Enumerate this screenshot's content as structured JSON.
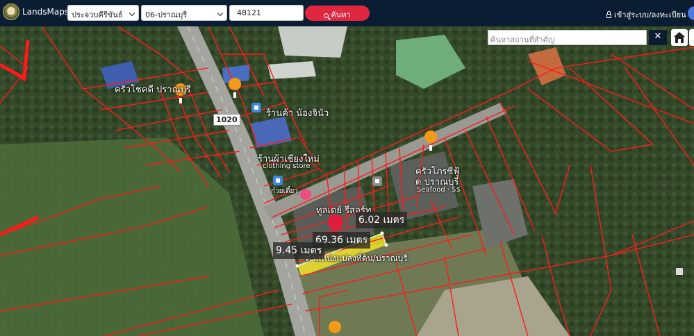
{
  "header": {
    "brand": "LandsMaps",
    "province": "ประจวบคีรีขันธ์",
    "district": "06-ปราณบุรี",
    "code": "48121",
    "search_label": "ค้นหา",
    "login_label": "เข้าสู่ระบบ/ลงทะเบียน"
  },
  "map": {
    "search_placeholder": "ค้นหาสถานที่สำคัญ",
    "clear_symbol": "✕",
    "road_number": "1020",
    "places": [
      "ครัวโชคดี ปราณบุรี",
      "ร้านค้า น้องจินัว",
      "ร้านผ้าเชียงใหม่",
      "clothing store",
      "ก๋วยเตี๋ยว",
      "ทูลเดย์ รีสอร์ท",
      "ครัวโภรซีฟู้",
      "ด ปราณบุรี",
      "Seafood · $$",
      "ตำแหน่งแปลงที่ดิน/ปราณบุรี"
    ],
    "measurements": [
      "6.02 เมตร",
      "69.36 เมตร",
      "9.45 เมตร"
    ]
  }
}
